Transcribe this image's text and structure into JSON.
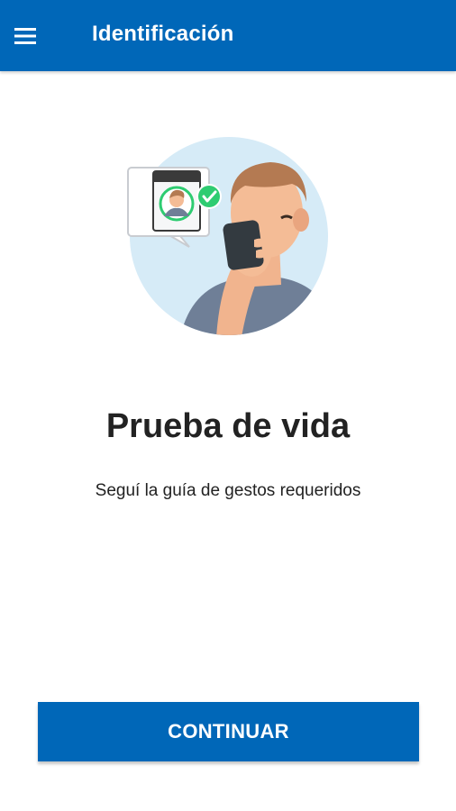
{
  "app_bar": {
    "title": "Identificación",
    "menu_icon": "hamburger-menu-icon",
    "color": "#0067b8"
  },
  "illustration": {
    "icon": "liveness-selfie-illustration"
  },
  "content": {
    "heading": "Prueba de vida",
    "subtitle": "Seguí la guía de gestos requeridos"
  },
  "actions": {
    "continue_label": "CONTINUAR"
  },
  "colors": {
    "primary": "#0067b8",
    "success": "#2ecc71",
    "text": "#222222"
  }
}
